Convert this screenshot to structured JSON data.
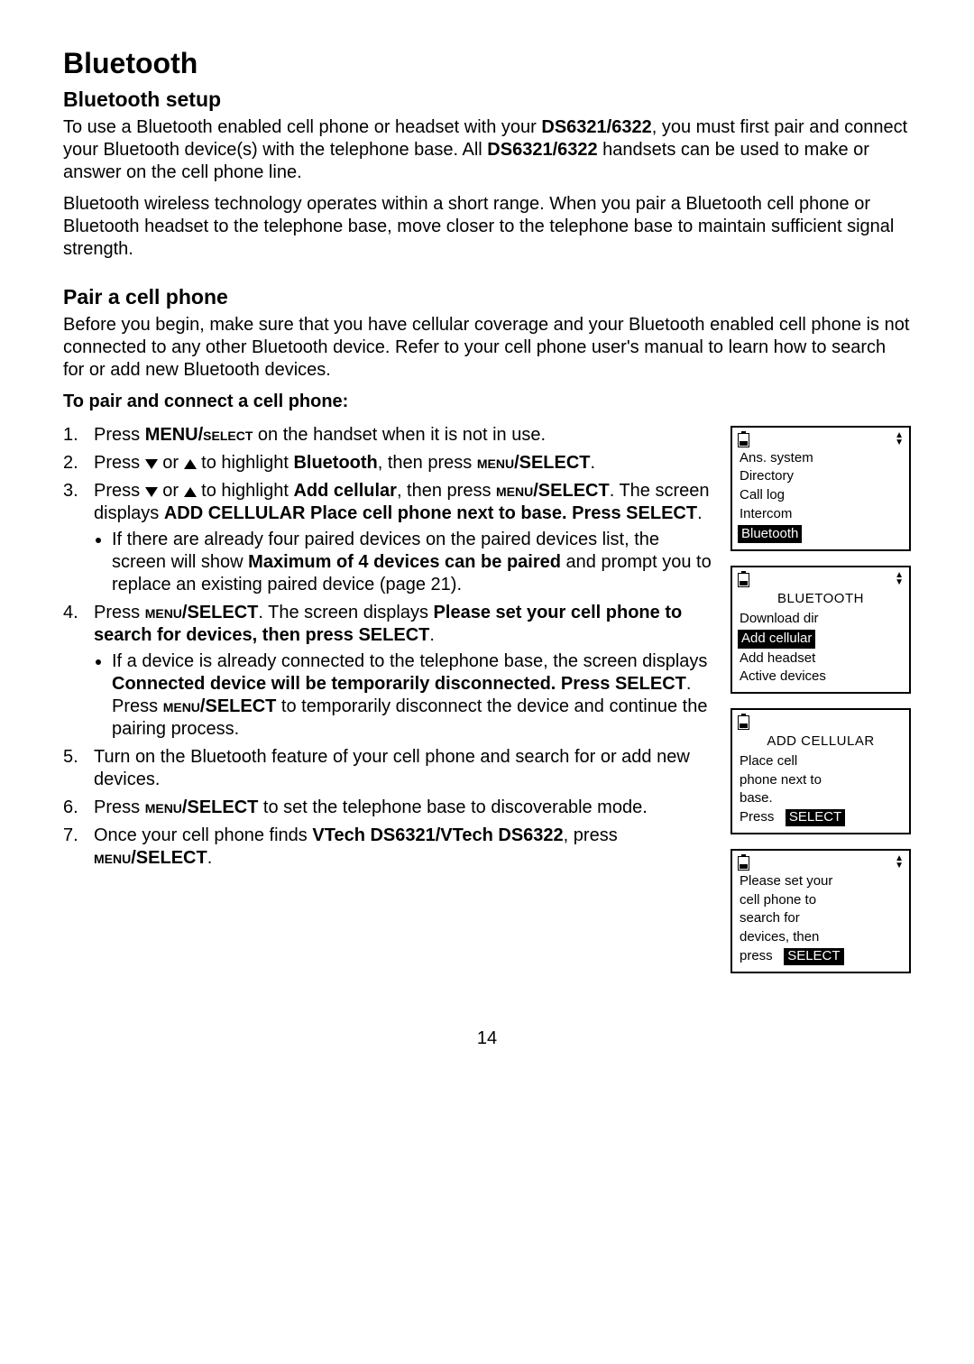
{
  "title": "Bluetooth",
  "sec1": {
    "heading": "Bluetooth setup",
    "p1a": "To use a Bluetooth enabled cell phone or headset with your ",
    "model": "DS6321/6322",
    "p1b": ", you must first pair and connect your Bluetooth device(s) with the telephone base. All ",
    "p1c": " handsets can be used to make or answer on the cell phone line.",
    "p2": "Bluetooth wireless technology operates within a short range. When you pair a Bluetooth cell phone or Bluetooth headset to the telephone base, move closer to the telephone base to maintain sufficient signal strength."
  },
  "sec2": {
    "heading": "Pair a cell phone",
    "intro": "Before you begin, make sure that you have cellular coverage and your Bluetooth enabled cell phone is not connected to any other Bluetooth device. Refer to your cell phone user's manual to learn how to search for or add new Bluetooth devices.",
    "sub": "To pair and connect a cell phone:",
    "s1a": "Press ",
    "s1b": "MENU/",
    "s1c": "select",
    "s1d": " on the handset when it is not in use.",
    "s2a": "Press ",
    "s2b": " or ",
    "s2c": " to highlight ",
    "s2d": "Bluetooth",
    "s2e": ", then press ",
    "s2f": "menu",
    "s2g": "/SELECT",
    "s2h": ".",
    "s3a": "Press ",
    "s3b": " or ",
    "s3c": " to highlight ",
    "s3d": "Add cellular",
    "s3e": ", then press ",
    "s3f": "menu",
    "s3g": "/SELECT",
    "s3h": ". The screen displays ",
    "s3i": "ADD CELLULAR Place cell phone next to base. Press SELECT",
    "s3j": ".",
    "s3sub_a": "If there are already four paired devices on the paired devices list, the screen will show ",
    "s3sub_b": "Maximum of 4 devices can be paired",
    "s3sub_c": " and prompt you to replace an existing paired device (page 21).",
    "s4a": "Press ",
    "s4b": "menu",
    "s4c": "/SELECT",
    "s4d": ". The screen displays ",
    "s4e": "Please set your cell phone to search for devices, then press SELECT",
    "s4f": ".",
    "s4sub_a": "If a device is already connected to the telephone base, the screen displays ",
    "s4sub_b": "Connected device will be temporarily disconnected. Press SELECT",
    "s4sub_c": ". Press ",
    "s4sub_d": "menu",
    "s4sub_e": "/SELECT",
    "s4sub_f": " to temporarily disconnect the device and continue the pairing process.",
    "s5": "Turn on the Bluetooth feature of your cell phone and search for or add new devices.",
    "s6a": "Press ",
    "s6b": "menu",
    "s6c": "/SELECT",
    "s6d": " to set the telephone base to discoverable mode.",
    "s7a": "Once your cell phone finds ",
    "s7b": "VTech DS6321/VTech DS6322",
    "s7c": ", press ",
    "s7d": "menu",
    "s7e": "/SELECT",
    "s7f": "."
  },
  "screens": {
    "menu": [
      "Ans. system",
      "Directory",
      "Call log",
      "Intercom",
      "Bluetooth"
    ],
    "bt_title": "BLUETOOTH",
    "bt": [
      "Download dir",
      "Add cellular",
      "Add headset",
      "Active devices"
    ],
    "add_title": "ADD CELLULAR",
    "add_lines": [
      "Place cell",
      "phone next to",
      "base."
    ],
    "add_press": "Press",
    "add_btn": "SELECT",
    "set_lines": [
      "Please set your",
      "cell phone to",
      "search for",
      "devices, then"
    ],
    "set_press": "press",
    "set_btn": "SELECT"
  },
  "page": "14"
}
